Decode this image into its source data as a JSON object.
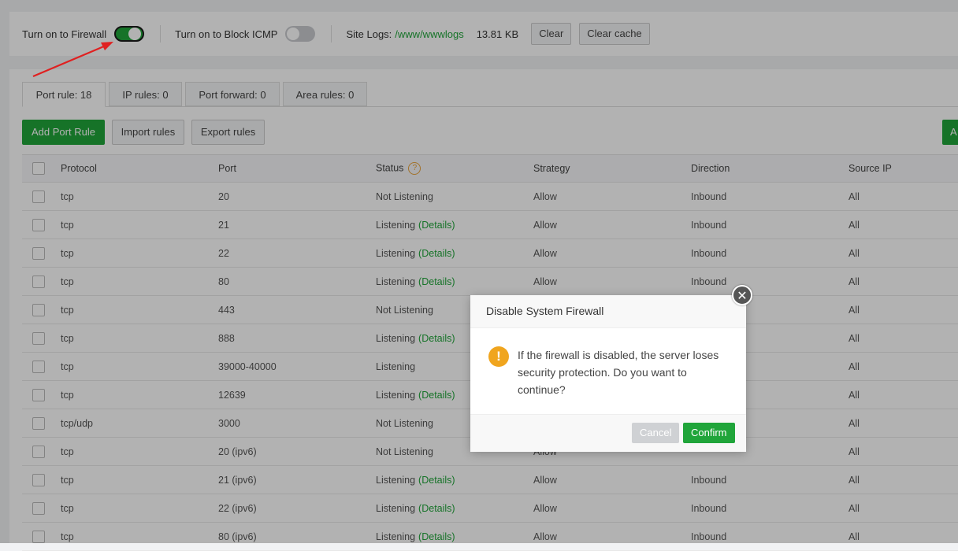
{
  "topbar": {
    "firewall_label": "Turn on to Firewall",
    "firewall_on": true,
    "icmp_label": "Turn on to Block ICMP",
    "icmp_on": false,
    "site_logs_label": "Site Logs:",
    "site_logs_path": "/www/wwwlogs",
    "site_logs_size": "13.81 KB",
    "clear_label": "Clear",
    "clear_cache_label": "Clear cache"
  },
  "tabs": [
    {
      "label": "Port rule: 18",
      "active": true
    },
    {
      "label": "IP rules: 0",
      "active": false
    },
    {
      "label": "Port forward: 0",
      "active": false
    },
    {
      "label": "Area rules: 0",
      "active": false
    }
  ],
  "actions": {
    "add_port_rule": "Add Port Rule",
    "import_rules": "Import rules",
    "export_rules": "Export rules",
    "right_button_partial": "A"
  },
  "table": {
    "headers": {
      "protocol": "Protocol",
      "port": "Port",
      "status": "Status",
      "strategy": "Strategy",
      "direction": "Direction",
      "source_ip": "Source IP"
    },
    "status_help_icon": "question-icon",
    "details_label": "(Details)",
    "rows": [
      {
        "protocol": "tcp",
        "port": "20",
        "status": "Not Listening",
        "details": false,
        "strategy": "Allow",
        "direction": "Inbound",
        "source": "All"
      },
      {
        "protocol": "tcp",
        "port": "21",
        "status": "Listening",
        "details": true,
        "strategy": "Allow",
        "direction": "Inbound",
        "source": "All"
      },
      {
        "protocol": "tcp",
        "port": "22",
        "status": "Listening",
        "details": true,
        "strategy": "Allow",
        "direction": "Inbound",
        "source": "All"
      },
      {
        "protocol": "tcp",
        "port": "80",
        "status": "Listening",
        "details": true,
        "strategy": "Allow",
        "direction": "Inbound",
        "source": "All"
      },
      {
        "protocol": "tcp",
        "port": "443",
        "status": "Not Listening",
        "details": false,
        "strategy": "",
        "direction": "",
        "source": "All"
      },
      {
        "protocol": "tcp",
        "port": "888",
        "status": "Listening",
        "details": true,
        "strategy": "",
        "direction": "",
        "source": "All"
      },
      {
        "protocol": "tcp",
        "port": "39000-40000",
        "status": "Listening",
        "details": false,
        "strategy": "",
        "direction": "",
        "source": "All"
      },
      {
        "protocol": "tcp",
        "port": "12639",
        "status": "Listening",
        "details": true,
        "strategy": "",
        "direction": "",
        "source": "All"
      },
      {
        "protocol": "tcp/udp",
        "port": "3000",
        "status": "Not Listening",
        "details": false,
        "strategy": "",
        "direction": "",
        "source": "All"
      },
      {
        "protocol": "tcp",
        "port": "20 (ipv6)",
        "status": "Not Listening",
        "details": false,
        "strategy": "Allow",
        "direction": "",
        "source": "All"
      },
      {
        "protocol": "tcp",
        "port": "21 (ipv6)",
        "status": "Listening",
        "details": true,
        "strategy": "Allow",
        "direction": "Inbound",
        "source": "All"
      },
      {
        "protocol": "tcp",
        "port": "22 (ipv6)",
        "status": "Listening",
        "details": true,
        "strategy": "Allow",
        "direction": "Inbound",
        "source": "All"
      },
      {
        "protocol": "tcp",
        "port": "80 (ipv6)",
        "status": "Listening",
        "details": true,
        "strategy": "Allow",
        "direction": "Inbound",
        "source": "All"
      }
    ]
  },
  "modal": {
    "title": "Disable System Firewall",
    "message": "If the firewall is disabled, the server loses security protection. Do you want to continue?",
    "cancel_label": "Cancel",
    "confirm_label": "Confirm",
    "close_icon": "close-icon",
    "warning_icon": "warning-icon"
  },
  "colors": {
    "accent": "#20a53a",
    "warning": "#f0a51e",
    "annotation_arrow": "#e02020"
  }
}
